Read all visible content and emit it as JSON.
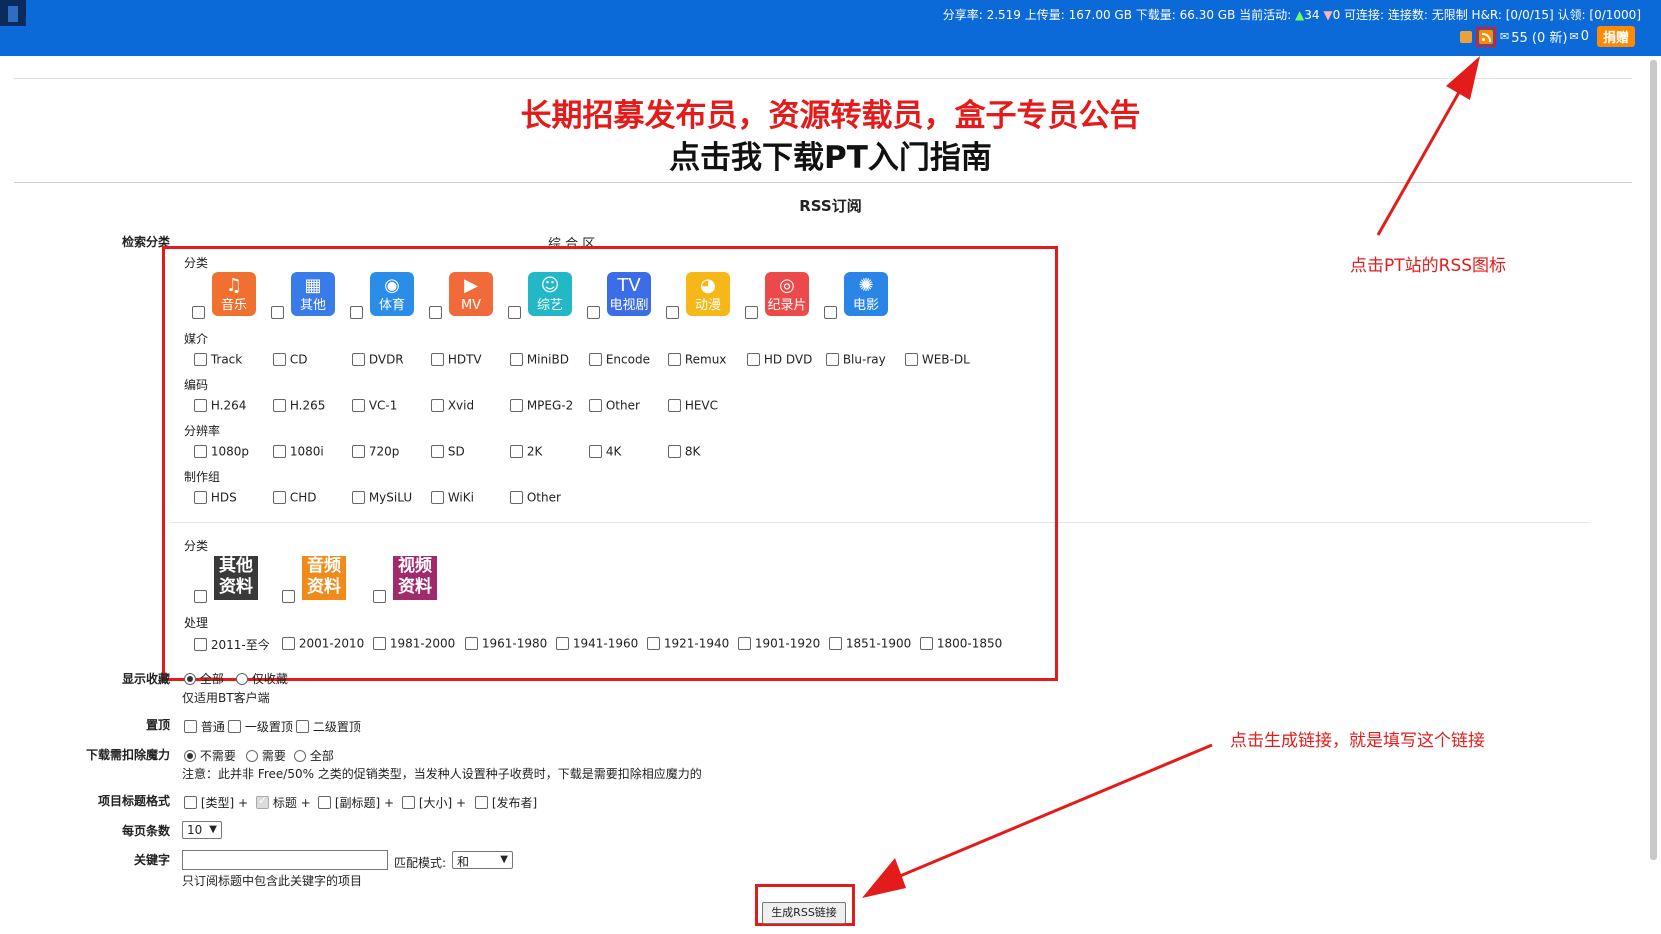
{
  "topbar": {
    "stats_prefix": "分享率: 2.519 上传量: 167.00 GB 下载量: 66.30 GB 当前活动: ",
    "active_up": "34",
    "active_down": "0",
    "stats_suffix": "  可连接: 连接数: 无限制 H&R: [0/0/15] 认领: [0/1000]",
    "messages": "55 (0 新)",
    "invites": "0",
    "donate_label": "捐赠"
  },
  "announcement": "长期招募发布员，资源转载员，盒子专员公告",
  "guide_link": "点击我下载PT入门指南",
  "page_title": "RSS订阅",
  "form": {
    "search_category_label": "检索分类",
    "zone_label": "综 合 区",
    "category_section_label": "分类",
    "categories": [
      {
        "name": "音乐",
        "icon": "music-note-icon",
        "color": "#f07030"
      },
      {
        "name": "其他",
        "icon": "grid-icon",
        "color": "#3a7bea"
      },
      {
        "name": "体育",
        "icon": "basketball-icon",
        "color": "#2a8ee8"
      },
      {
        "name": "MV",
        "icon": "video-camera-icon",
        "color": "#f26a3a"
      },
      {
        "name": "综艺",
        "icon": "person-icon",
        "color": "#22b8c8"
      },
      {
        "name": "电视剧",
        "icon": "tv-icon",
        "color": "#3a6de6"
      },
      {
        "name": "动漫",
        "icon": "bear-icon",
        "color": "#f6b818"
      },
      {
        "name": "纪录片",
        "icon": "camera-icon",
        "color": "#ec4a4a"
      },
      {
        "name": "电影",
        "icon": "film-reel-icon",
        "color": "#2a86e6"
      }
    ],
    "media_label": "媒介",
    "media": [
      "Track",
      "CD",
      "DVDR",
      "HDTV",
      "MiniBD",
      "Encode",
      "Remux",
      "HD DVD",
      "Blu-ray",
      "WEB-DL"
    ],
    "codec_label": "编码",
    "codecs": [
      "H.264",
      "H.265",
      "VC-1",
      "Xvid",
      "MPEG-2",
      "Other",
      "HEVC"
    ],
    "resolution_label": "分辨率",
    "resolutions": [
      "1080p",
      "1080i",
      "720p",
      "SD",
      "2K",
      "4K",
      "8K"
    ],
    "group_label": "制作组",
    "groups": [
      "HDS",
      "CHD",
      "MySiLU",
      "WiKi",
      "Other"
    ],
    "category2_label": "分类",
    "categories2": [
      {
        "line1": "其他",
        "line2": "资料",
        "color": "#3a3a3a"
      },
      {
        "line1": "音频",
        "line2": "资料",
        "color": "#f08a18"
      },
      {
        "line1": "视频",
        "line2": "资料",
        "color": "#a02a6a"
      }
    ],
    "process_label": "处理",
    "eras": [
      "2011-至今",
      "2001-2010",
      "1981-2000",
      "1961-1980",
      "1941-1960",
      "1921-1940",
      "1901-1920",
      "1851-1900",
      "1800-1850"
    ],
    "show_bookmarked_label": "显示收藏",
    "show_all": "全部",
    "show_bookmarked_only": "仅收藏",
    "bt_only_note": "仅适用BT客户端",
    "sticky_label": "置顶",
    "sticky_options": [
      "普通",
      "一级置顶",
      "二级置顶"
    ],
    "magic_label": "下载需扣除魔力",
    "magic_options": [
      "不需要",
      "需要",
      "全部"
    ],
    "magic_note": "注意：此并非 Free/50% 之类的促销类型，当发种人设置种子收费时，下载是需要扣除相应魔力的",
    "title_format_label": "项目标题格式",
    "title_format_options": [
      "[类型] +",
      "标题 +",
      "[副标题] +",
      "[大小] +",
      "[发布者]"
    ],
    "per_page_label": "每页条数",
    "per_page_value": "10",
    "keyword_label": "关键字",
    "keyword_value": "",
    "match_mode_label": "匹配模式:",
    "match_mode_value": "和",
    "keyword_note": "只订阅标题中包含此关键字的项目",
    "generate_button": "生成RSS链接"
  },
  "annotations": {
    "rss_icon_note": "点击PT站的RSS图标",
    "generate_note": "点击生成链接，就是填写这个链接"
  },
  "colors": {
    "topbar": "#0b6ad8",
    "annotation_red": "#e41b1b",
    "donate": "#ff8a00"
  }
}
